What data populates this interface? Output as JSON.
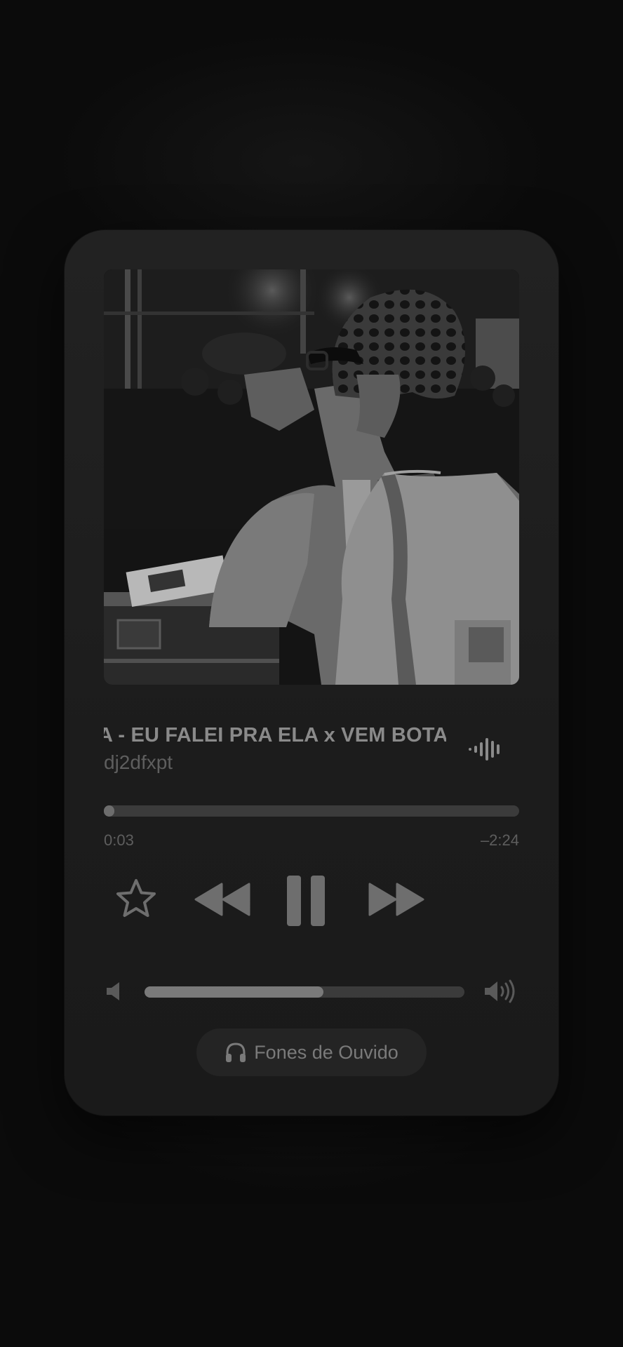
{
  "player": {
    "track_title": "A - EU FALEI PRA ELA x VEM BOTA",
    "artist": "dj2dfxpt",
    "elapsed": "0:03",
    "remaining": "–2:24",
    "progress_fraction": 0.02,
    "volume_fraction": 0.56,
    "is_playing": true,
    "favorited": false
  },
  "route": {
    "label": "Fones de Ouvido",
    "icon": "headphones-icon"
  },
  "icons": {
    "star": "star-icon",
    "rewind": "backward-icon",
    "pause": "pause-icon",
    "forward": "forward-icon",
    "volume_low": "speaker-low-icon",
    "volume_high": "speaker-high-icon",
    "waveform": "waveform-icon"
  },
  "colors": {
    "card_bg": "#1e1e1e",
    "control": "#6e6e6e",
    "text_primary": "#8a8a8a",
    "text_secondary": "#5e5e5e"
  }
}
